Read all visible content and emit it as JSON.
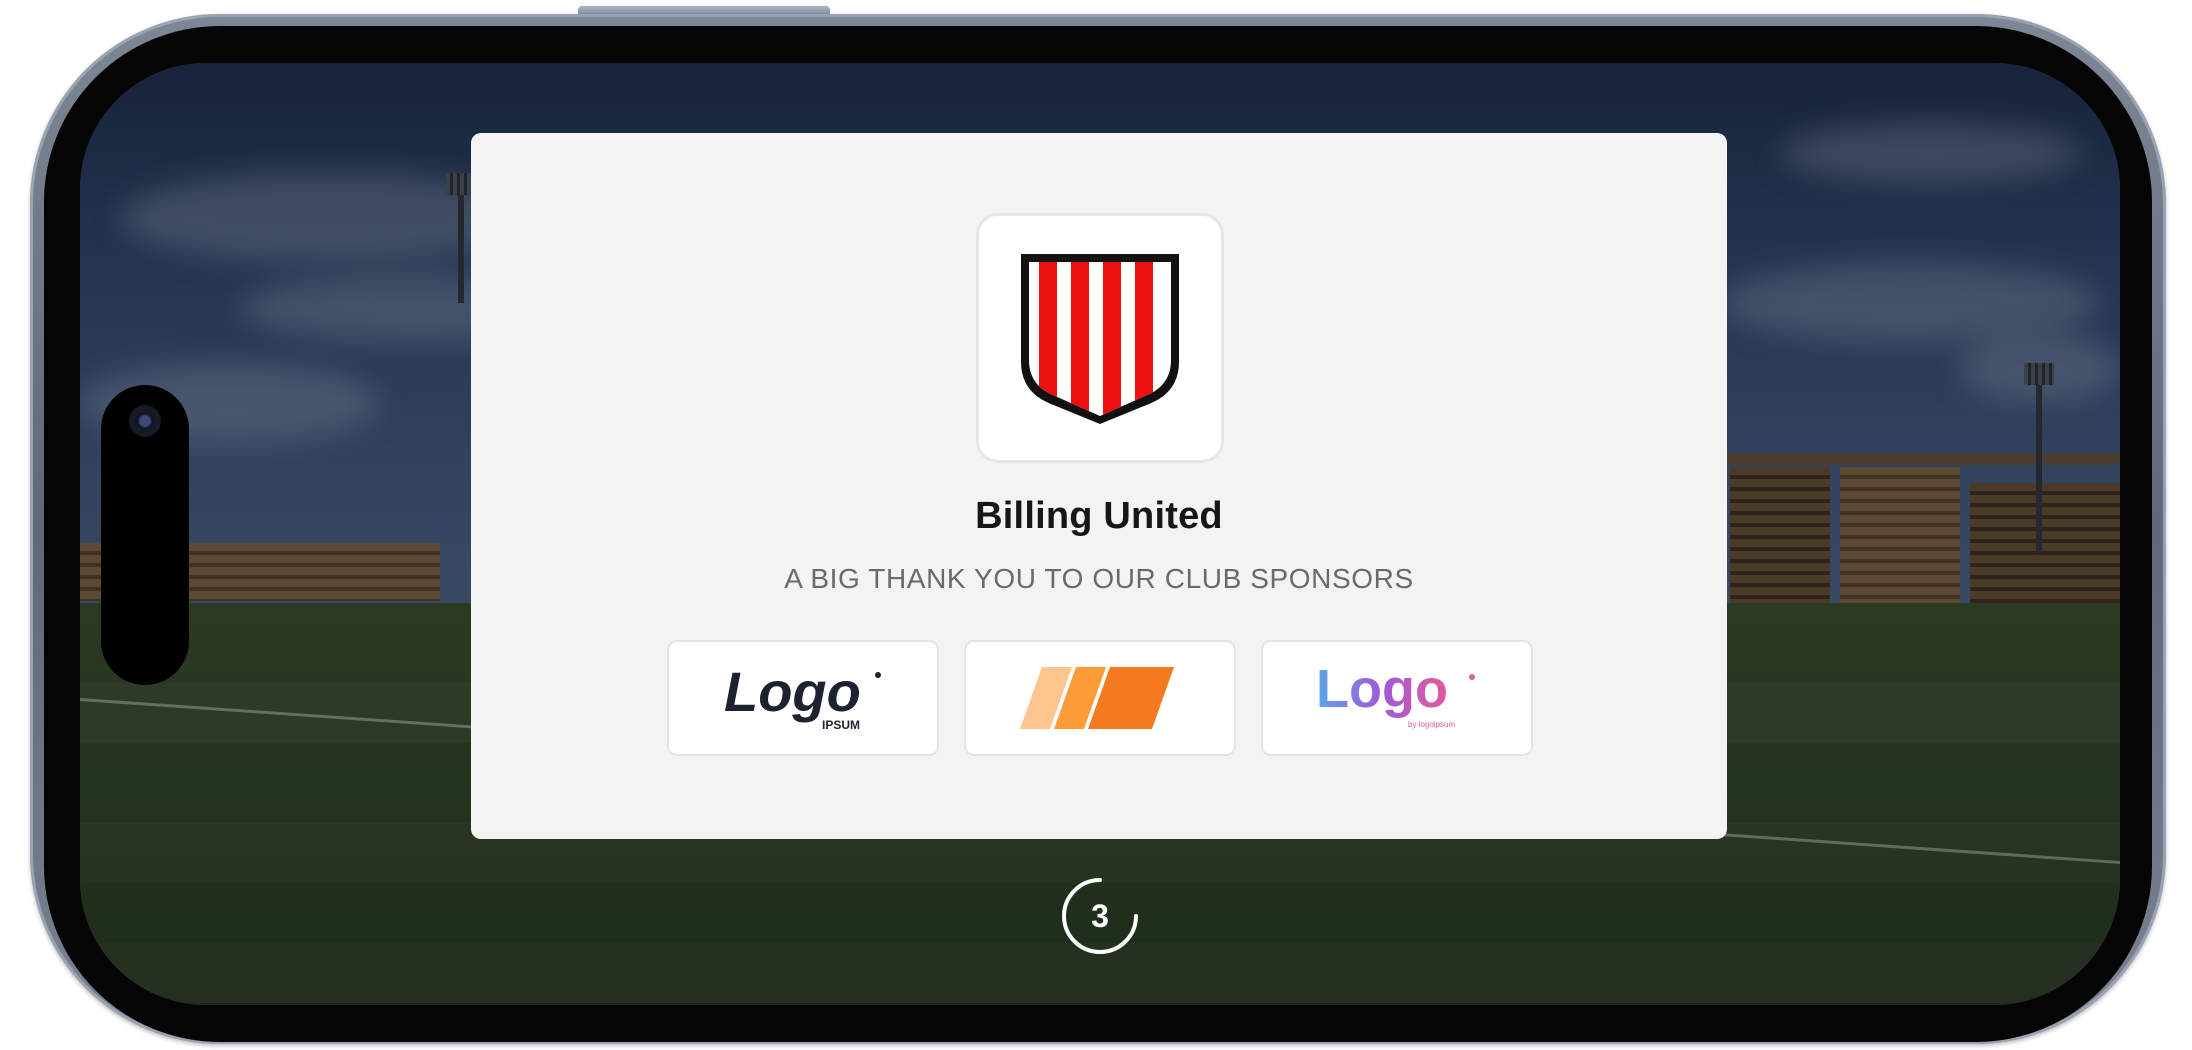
{
  "club": {
    "name": "Billing United",
    "crest_colors": {
      "stripe_red": "#ee1111",
      "outline": "#111111",
      "background": "#ffffff"
    }
  },
  "sponsors_message": "A BIG THANK YOU TO OUR CLUB SPONSORS",
  "sponsors": [
    {
      "icon": "logo-ipsum-wordmark-icon",
      "text": "Logo",
      "subtext": "IPSUM",
      "color": "#1c2230"
    },
    {
      "icon": "orange-stripes-logo-icon",
      "colors": [
        "#ffc58f",
        "#ff9c3a",
        "#f57a1f"
      ]
    },
    {
      "icon": "gradient-logo-wordmark-icon",
      "text": "Logo",
      "subtext": "by logoipsum",
      "colors": [
        "#5aa6e8",
        "#a05ad8",
        "#e25a9a"
      ]
    }
  ],
  "countdown": {
    "value": "3"
  },
  "colors": {
    "card_background": "#f3f3f3",
    "title_text": "#161616",
    "subtitle_text": "#6a6a6a"
  }
}
